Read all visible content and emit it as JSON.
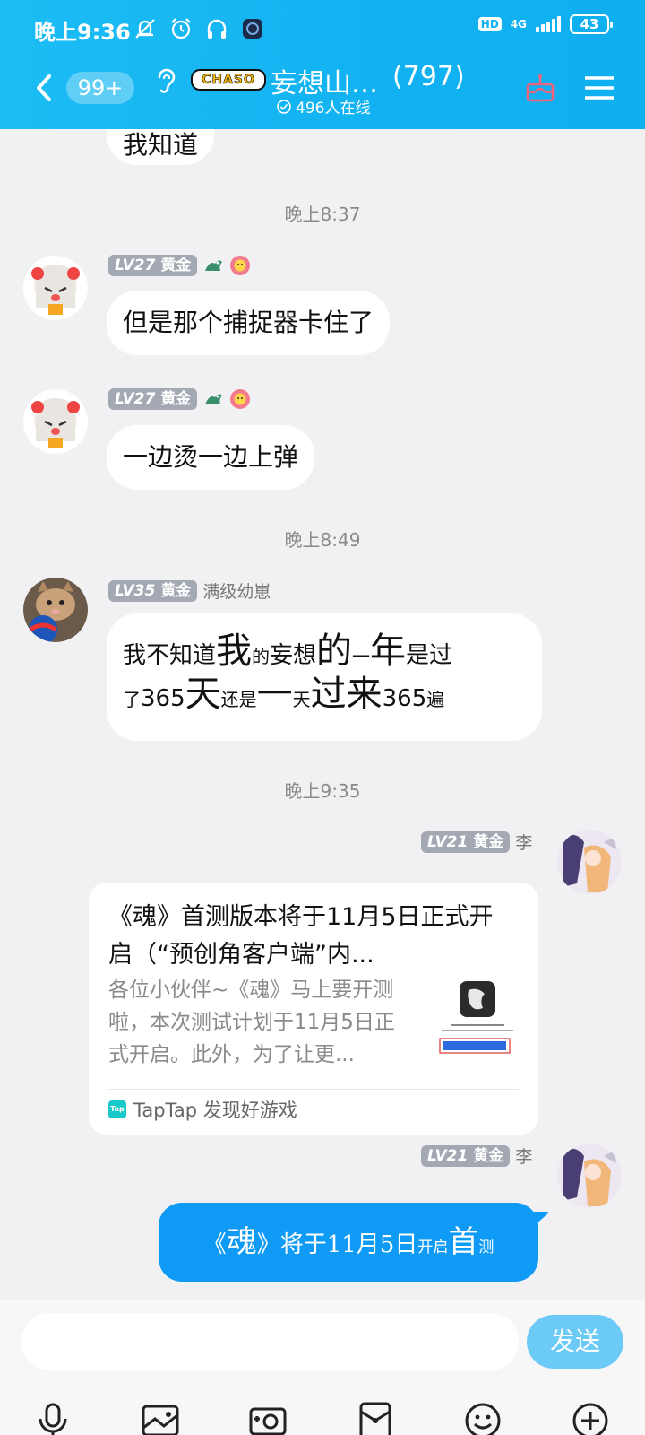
{
  "status_bar": {
    "time": "晚上9:36",
    "network": "4G",
    "hd": "HD",
    "battery": "43"
  },
  "header": {
    "unread_count": "99+",
    "logo_text": "CHASO",
    "group_name": "妄想山…",
    "member_count": "(797)",
    "online": "496人在线"
  },
  "messages": {
    "partial_text": "我知道",
    "time1": "晚上8:37",
    "m1": {
      "level": "LV27",
      "rank": "黄金",
      "text": "但是那个捕捉器卡住了"
    },
    "m2": {
      "level": "LV27",
      "rank": "黄金",
      "text": "一边烫一边上弹"
    },
    "time2": "晚上8:49",
    "m3": {
      "level": "LV35",
      "rank": "黄金",
      "title": "满级幼崽",
      "line1": {
        "a": "我不知道",
        "b": "我",
        "c": "的",
        "d": "妄想",
        "e": "的",
        "f": "一",
        "g": "年",
        "h": "是过"
      },
      "line2": {
        "a": "了",
        "b": "365",
        "c": "天",
        "d": "还是",
        "e": "一",
        "f": "天",
        "g": "过来",
        "h": "365",
        "i": "遍"
      }
    },
    "time3": "晚上9:35",
    "m4": {
      "level": "LV21",
      "rank": "黄金",
      "name": "李",
      "card_title": "《魂》首测版本将于11月5日正式开启（“预创角客户端”内...",
      "card_desc": "各位小伙伴~《魂》马上要开测啦，本次测试计划于11月5日正式开启。此外，为了让更...",
      "source": "TapTap 发现好游戏",
      "tap_icon": "Tap"
    },
    "m5": {
      "level": "LV21",
      "rank": "黄金",
      "name": "李",
      "a": "《",
      "b": "魂",
      "c": "》将于11月5日",
      "d": "开启",
      "e": "首",
      "f": "测"
    }
  },
  "input": {
    "placeholder": "",
    "send_label": "发送"
  },
  "toolbar": {
    "icons": [
      "microphone-icon",
      "image-icon",
      "camera-icon",
      "red-packet-icon",
      "emoji-icon",
      "plus-icon"
    ]
  }
}
